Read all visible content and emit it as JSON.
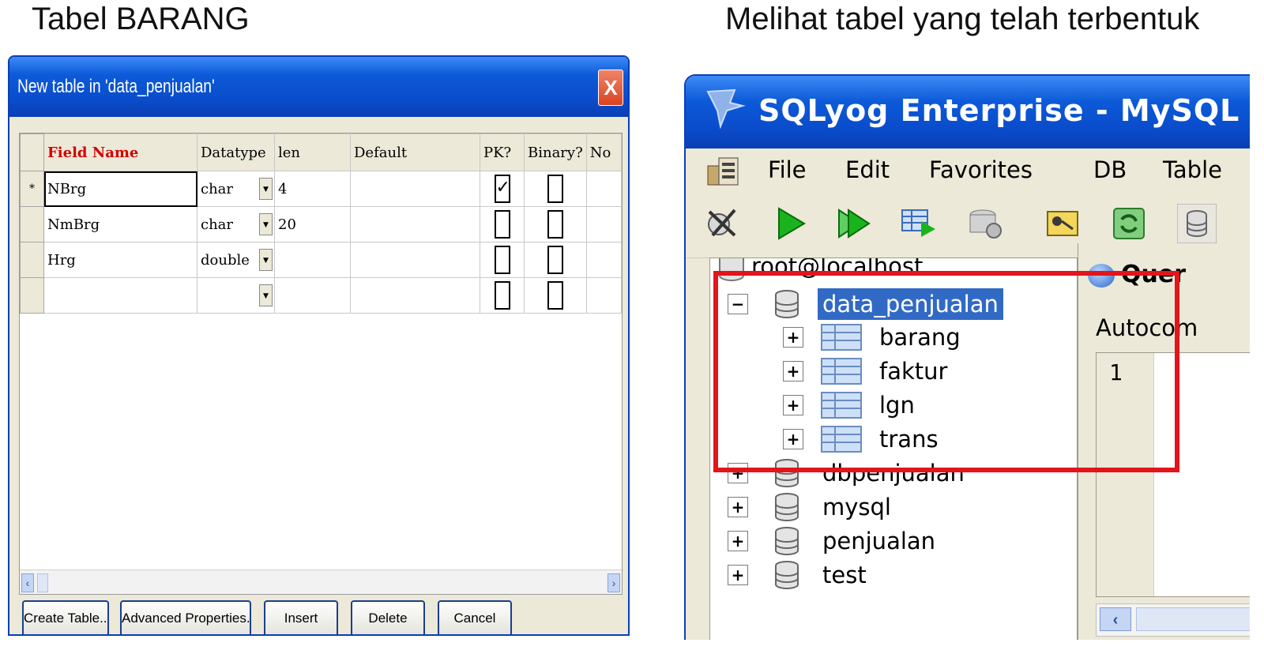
{
  "captions": {
    "left": "Tabel BARANG",
    "right": "Melihat tabel yang telah terbentuk"
  },
  "dialog": {
    "title": "New table in 'data_penjualan'",
    "close_symbol": "X",
    "columns": [
      "Field Name",
      "Datatype",
      "len",
      "Default",
      "PK?",
      "Binary?",
      "No"
    ],
    "rows": [
      {
        "marker": "*",
        "field": "NBrg",
        "datatype": "char",
        "len": "4",
        "default": "",
        "pk": true,
        "binary": false
      },
      {
        "marker": "",
        "field": "NmBrg",
        "datatype": "char",
        "len": "20",
        "default": "",
        "pk": false,
        "binary": false
      },
      {
        "marker": "",
        "field": "Hrg",
        "datatype": "double",
        "len": "",
        "default": "",
        "pk": false,
        "binary": false
      },
      {
        "marker": "",
        "field": "",
        "datatype": "",
        "len": "",
        "default": "",
        "pk": false,
        "binary": false
      }
    ],
    "buttons": {
      "create": "Create Table...",
      "advanced": "Advanced Properties...",
      "insert": "Insert",
      "delete": "Delete",
      "cancel": "Cancel"
    }
  },
  "sqlyog": {
    "title": "SQLyog Enterprise - MySQL",
    "menu": [
      "File",
      "Edit",
      "Favorites",
      "DB",
      "Table"
    ],
    "tree": {
      "root": "root@localhost",
      "selected_db": "data_penjualan",
      "tables": [
        "barang",
        "faktur",
        "lgn",
        "trans"
      ],
      "other_dbs": [
        "dbpenjualan",
        "mysql",
        "penjualan",
        "test"
      ]
    },
    "query_tab": "Quer",
    "autocomplete": "Autocom",
    "line_number": "1"
  },
  "colors": {
    "xp_blue": "#0a4dcc",
    "highlight_red": "#e3141a",
    "field_name_red": "#d40000",
    "selection_blue": "#316ac5"
  }
}
